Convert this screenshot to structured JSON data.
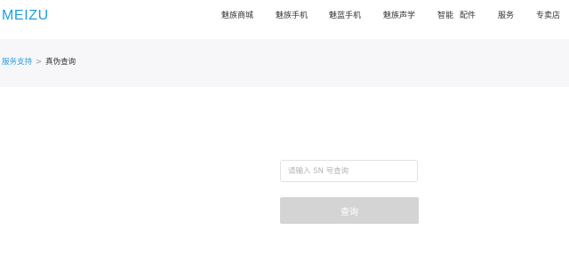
{
  "header": {
    "logo_text": "MEIZU",
    "nav": [
      {
        "label": "魅族商城"
      },
      {
        "label": "魅族手机"
      },
      {
        "label": "魅蓝手机"
      },
      {
        "label": "魅族声学"
      },
      {
        "label": "智能"
      },
      {
        "label": "配件"
      },
      {
        "label": "服务"
      },
      {
        "label": "专卖店"
      }
    ]
  },
  "breadcrumb": {
    "parent": "服务支持",
    "separator": ">",
    "current": "真伪查询"
  },
  "form": {
    "sn_placeholder": "请输入 SN 号查询",
    "sn_value": "",
    "submit_label": "查询"
  },
  "colors": {
    "brand": "#1d9ee0",
    "link": "#2f9fde",
    "button_disabled": "#d4d4d4",
    "background": "#f7f7f9"
  }
}
